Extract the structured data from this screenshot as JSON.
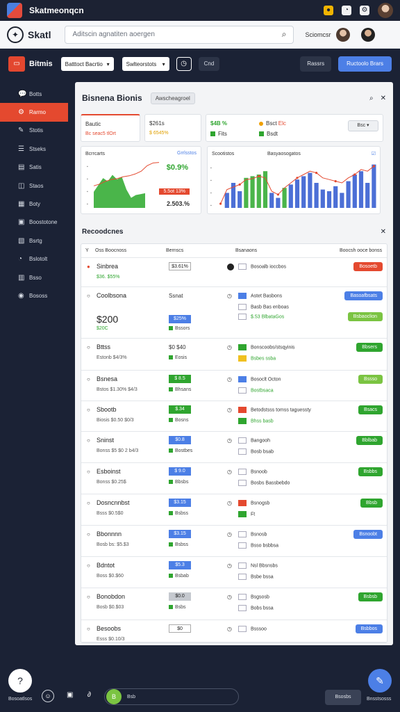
{
  "os": {
    "title": "Skatmeonqcn"
  },
  "header": {
    "brand": "Skatl",
    "search_placeholder": "Aditscin agnatiten aoergen",
    "user_label": "Sciomcsr"
  },
  "toolbar": {
    "name": "Bitmis",
    "select1": "Batttoct Bacrtio",
    "select2": "Swlteorstots",
    "chip": "Cnd",
    "btn_dark": "Rassrs",
    "btn_blue": "Ructoolo Brars"
  },
  "sidebar": {
    "items": [
      {
        "icon": "💬",
        "label": "Botts"
      },
      {
        "icon": "⚙",
        "label": "Rarmo"
      },
      {
        "icon": "✎",
        "label": "Stotis"
      },
      {
        "icon": "☰",
        "label": "Stseks"
      },
      {
        "icon": "▤",
        "label": "Satis"
      },
      {
        "icon": "◫",
        "label": "Staos"
      },
      {
        "icon": "▦",
        "label": "Boty"
      },
      {
        "icon": "▣",
        "label": "Boostotone"
      },
      {
        "icon": "▧",
        "label": "Bsrtg"
      },
      {
        "icon": "◔",
        "label": "Bslotolt"
      },
      {
        "icon": "▥",
        "label": "Bsso"
      },
      {
        "icon": "◉",
        "label": "Bososs"
      }
    ]
  },
  "panel": {
    "title": "Bisnena Bionis",
    "tag": "Awscheagroel",
    "stat_a": {
      "label": "Bautic",
      "sub": "Bc seac5 tlOrt"
    },
    "stat_b": {
      "label": "$261s",
      "sub": "$ 6545%"
    },
    "stat_c": {
      "label1": "$4B %",
      "sub1": "Fits",
      "label2": "Bsct",
      "label2b": "Elc",
      "select": "Bsc"
    },
    "chart1": {
      "title": "Bcrrcarts",
      "corner": "Grrlsstos",
      "big": "$0.9%",
      "pill": "5.5ot 13%",
      "val": "2.503.%"
    },
    "chart2": {
      "title": "Scootistos",
      "title2": "Basyaosogatos"
    },
    "records_title": "Recoodcnes"
  },
  "table": {
    "headers": [
      "Oss Boocnoss",
      "Bernscs",
      "Bsanaons",
      "Boocsh ooce bonss"
    ],
    "rows": [
      {
        "icon": "●",
        "name": "Sinbrea",
        "sub": "$36. $55%",
        "badge": "$3.61%",
        "badge_style": "white",
        "ricon": "dark",
        "rlbl": "Bosoalb ioccbos",
        "btn": "Bosoetb",
        "btn_style": "orange"
      },
      {
        "icon": "○",
        "name": "Coolbsona",
        "num": "$200",
        "sub2": "$20C",
        "plain": "Ssnat",
        "badge2": "$25%",
        "badge2_sub": "Bssors",
        "rlbl": "Astet Basbons",
        "rlbl2": "Basb Bas enboas",
        "rlbl3": "$.53 BlbataGos",
        "btn": "Basoafbsats",
        "btn_style": "blue",
        "btn2": "Bsbaoclion"
      },
      {
        "icon": "○",
        "name": "Bttss",
        "sub": "Estonb $4/3%",
        "plain": "$0 $40",
        "badge_sub": "Eosis",
        "rlbl": "Bonscoobs/stsqyinis",
        "rlbl2": "Bsbes ssba",
        "btn": "Bbsers",
        "btn_style": "green"
      },
      {
        "icon": "○",
        "name": "Bsnesa",
        "sub": "Bstos $1.30% $4/3",
        "badge": "$ 8.5",
        "badge_style": "green",
        "badge_sub": "Bhsans",
        "rlbl": "Bosoclt Octon",
        "rlbl2": "Bostbsaca",
        "btn": "Bssso",
        "btn_style": "lgreen"
      },
      {
        "icon": "○",
        "name": "Sbootb",
        "sub": "Biosis $0.50 $0/3",
        "badge": "$.34",
        "badge_style": "green",
        "badge_sub": "Bosns",
        "rlbl": "Betodstsss tomss taguessty",
        "rlbl2": "Bhss basb",
        "btn": "Bsacs",
        "btn_style": "green"
      },
      {
        "icon": "○",
        "name": "Sninst",
        "sub": "Bonss $5 $0 2 b4/3",
        "badge": "$0.8",
        "badge_style": "blue",
        "badge_sub": "Bostbes",
        "rlbl": "Bangooh",
        "rlbl2": "Bosb bsab",
        "btn": "Bblbab",
        "btn_style": "green"
      },
      {
        "icon": "○",
        "name": "Esboinst",
        "sub": "Bonss $0.25$",
        "badge": "$ 9.0",
        "badge_style": "blue",
        "badge_sub": "Bbsbs",
        "rlbl": "Bsnoob",
        "rlbl2": "Bosbs Bassbebdo",
        "btn": "Bsbbs",
        "btn_style": "green"
      },
      {
        "icon": "○",
        "name": "Dosncnnbst",
        "sub": "Bsss $0.5$0",
        "badge": "$3.15",
        "badge_style": "blue",
        "badge_sub": "Bsbss",
        "rlbl": "Bsnogsb",
        "rlbl2": "Ft",
        "btn": "Bbsb",
        "btn_style": "green"
      },
      {
        "icon": "○",
        "name": "Bbonnnn",
        "sub": "Bosb bs: $5.$3",
        "badge": "$3.15",
        "badge_style": "blue",
        "badge_sub": "Bsbss",
        "rlbl": "Bsnosb",
        "rlbl2": "Bsso bsbbsa",
        "btn": "Bsnoobt",
        "btn_style": "blue"
      },
      {
        "icon": "○",
        "name": "Bdntot",
        "sub": "Boss $0.$60",
        "badge": "$5.3",
        "badge_style": "blue",
        "badge_sub": "Bsbab",
        "rlbl": "Nsl Bbsnsbs",
        "rlbl2": "Bsbe bssa",
        "btn": "",
        "btn_style": ""
      },
      {
        "icon": "○",
        "name": "Bonobdon",
        "sub": "Bosb $0.$03",
        "badge": "$0.0",
        "badge_style": "grey",
        "badge_sub": "Bsbs",
        "rlbl": "Bsgsosb",
        "rlbl2": "Bobs bssa",
        "btn": "Bsbsb",
        "btn_style": "green"
      },
      {
        "icon": "○",
        "name": "Besoobs",
        "sub": "Esss $0.10/3",
        "badge": "$0",
        "badge_style": "white",
        "rlbl": "Bsssoo",
        "btn": "Bsbbos",
        "btn_style": "blue"
      }
    ]
  },
  "footer": {
    "left_label": "Bosoatlsos",
    "input_text": "Bsb",
    "avatar": "B",
    "btn": "Bsosbs",
    "right_label": "Bnsstsosss"
  },
  "chart_data": [
    {
      "type": "area",
      "title": "Bcrrcarts",
      "x": [
        1,
        2,
        3,
        4,
        5,
        6,
        7,
        8,
        9,
        10,
        11,
        12
      ],
      "values": [
        35,
        50,
        65,
        58,
        72,
        62,
        68,
        40,
        22,
        28,
        30,
        32
      ],
      "overlay_line": [
        48,
        52,
        58,
        62,
        64,
        68,
        70,
        74,
        80,
        92,
        98,
        99
      ]
    },
    {
      "type": "bar",
      "title": "Scootistos",
      "categories": [
        "1",
        "2",
        "3",
        "4",
        "5",
        "6",
        "7",
        "8",
        "9",
        "10",
        "11",
        "12",
        "13",
        "14",
        "15",
        "16",
        "17",
        "18",
        "19",
        "20",
        "21",
        "22",
        "23",
        "24",
        "25"
      ],
      "series": [
        {
          "values": [
            0,
            18,
            30,
            20,
            36,
            38,
            40,
            44,
            18,
            12,
            24,
            28,
            34,
            38,
            42,
            30,
            22,
            20,
            26,
            18,
            32,
            40,
            44,
            30,
            52
          ]
        },
        {
          "values": [
            5,
            22,
            25,
            28,
            34,
            35,
            38,
            36,
            20,
            16,
            24,
            30,
            36,
            40,
            44,
            42,
            36,
            34,
            32,
            30,
            36,
            40,
            46,
            44,
            50
          ]
        }
      ]
    }
  ]
}
